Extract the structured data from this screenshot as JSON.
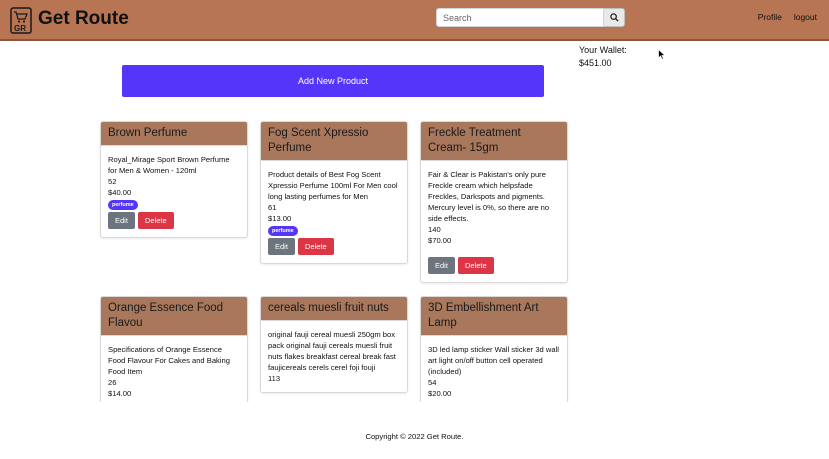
{
  "navbar": {
    "logo_text": "GR",
    "brand": "Get Route",
    "search_placeholder": "Search",
    "links": [
      "Profile",
      "logout"
    ]
  },
  "wallet": {
    "label": "Your Wallet:",
    "amount": "$451.00"
  },
  "add_button": "Add New Product",
  "buttons": {
    "edit": "Edit",
    "delete": "Delete"
  },
  "products": [
    {
      "title": "Brown Perfume",
      "description": "Royal_Mirage Sport Brown Perfume for Men & Women - 120ml",
      "quantity": "52",
      "price": "$40.00",
      "tag": "perfume"
    },
    {
      "title": "Fog Scent Xpressio Perfume",
      "description": "Product details of Best Fog Scent Xpressio Perfume 100ml For Men cool long lasting perfumes for Men",
      "quantity": "61",
      "price": "$13.00",
      "tag": "perfume"
    },
    {
      "title": "Freckle Treatment Cream- 15gm",
      "description": "Fair & Clear is Pakistan's only pure Freckle cream which helpsfade Freckles, Darkspots and pigments. Mercury level is 0%, so there are no side effects.",
      "quantity": "140",
      "price": "$70.00",
      "tag": ""
    },
    {
      "title": "Orange Essence Food Flavou",
      "description": "Specifications of Orange Essence Food Flavour For Cakes and Baking Food Item",
      "quantity": "26",
      "price": "$14.00",
      "tag": ""
    },
    {
      "title": "cereals muesli fruit nuts",
      "description": "original fauji cereal muesli 250gm box pack original fauji cereals muesli fruit nuts flakes breakfast cereal break fast faujicereals cerels cerel foji fouji",
      "quantity": "113",
      "price": "",
      "tag": ""
    },
    {
      "title": "3D Embellishment Art Lamp",
      "description": "3D led lamp sticker Wall sticker 3d wall art light on/off button cell operated (included)",
      "quantity": "54",
      "price": "$20.00",
      "tag": ""
    }
  ],
  "footer": "Copyright © 2022 Get Route."
}
